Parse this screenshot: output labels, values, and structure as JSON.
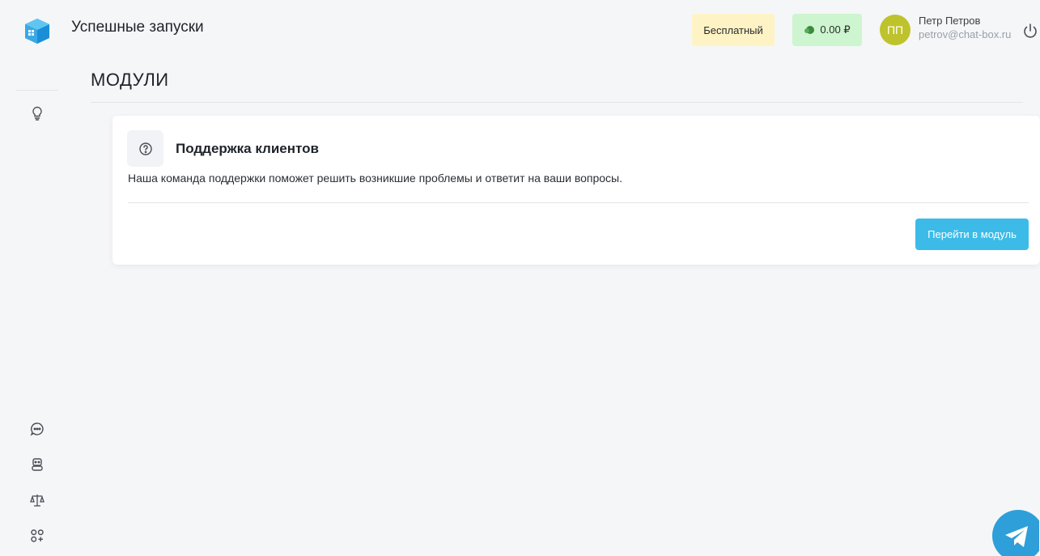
{
  "header": {
    "title": "Успешные запуски",
    "plan_badge": "Бесплатный",
    "balance": "0.00 ₽",
    "user": {
      "initials": "ПП",
      "name": "Петр Петров",
      "email": "petrov@chat-box.ru"
    }
  },
  "sidebar": {
    "items": [
      {
        "icon": "lightbulb-icon"
      },
      {
        "icon": "chat-bubble-icon"
      },
      {
        "icon": "robot-icon"
      },
      {
        "icon": "scales-icon"
      },
      {
        "icon": "apps-add-icon"
      }
    ]
  },
  "main": {
    "page_title": "МОДУЛИ",
    "modules": [
      {
        "icon": "question-circle-icon",
        "title": "Поддержка клиентов",
        "description": "Наша команда поддержки поможет решить возникшие проблемы и ответит на ваши вопросы.",
        "button_label": "Перейти в модуль"
      }
    ]
  },
  "colors": {
    "accent": "#3dbbe8",
    "plan_badge_bg": "#fdf3c5",
    "balance_badge_bg": "#cdf5cf",
    "avatar_bg": "#bfc32b",
    "telegram": "#2e9fd9"
  }
}
